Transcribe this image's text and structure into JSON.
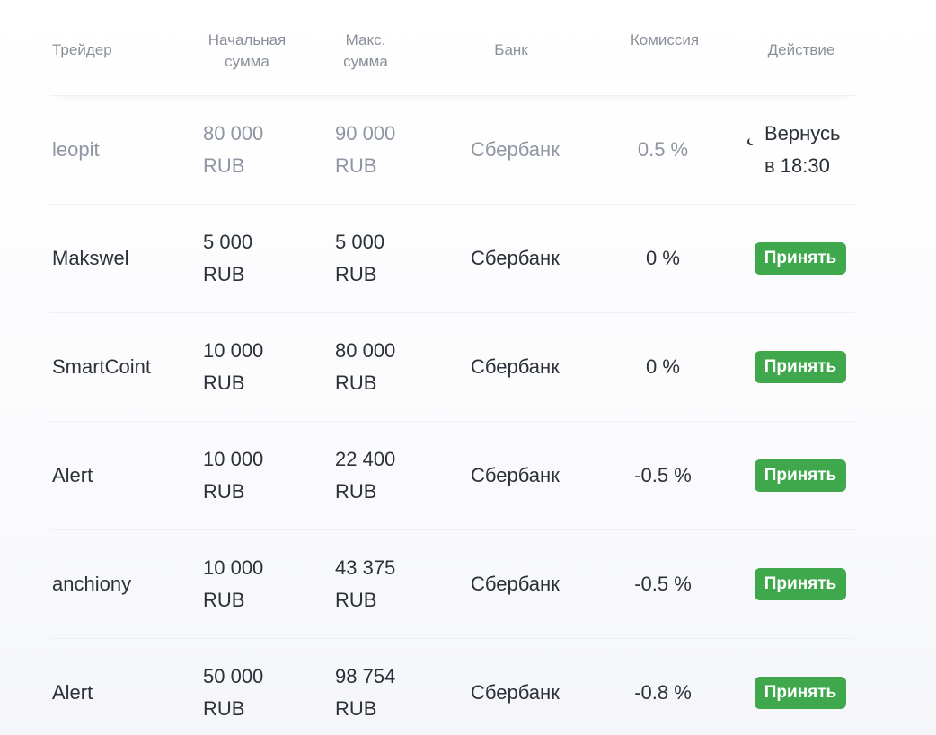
{
  "headers": {
    "trader": "Трейдер",
    "start_amount": [
      "Начальная",
      "сумма"
    ],
    "max_amount": [
      "Макс.",
      "сумма"
    ],
    "bank": "Банк",
    "fee": "Комиссия",
    "action": "Действие"
  },
  "rows": [
    {
      "trader": "leopit",
      "start_amount": [
        "80 000",
        "RUB"
      ],
      "max_amount": [
        "90 000",
        "RUB"
      ],
      "bank": "Сбербанк",
      "fee": "0.5 %",
      "action": {
        "type": "away",
        "text": [
          "Вернусь",
          "в 18:30"
        ]
      }
    },
    {
      "trader": "Makswel",
      "start_amount": [
        "5 000",
        "RUB"
      ],
      "max_amount": [
        "5 000",
        "RUB"
      ],
      "bank": "Сбербанк",
      "fee": "0 %",
      "action": {
        "type": "button",
        "label": "Принять"
      }
    },
    {
      "trader": "SmartCoint",
      "start_amount": [
        "10 000",
        "RUB"
      ],
      "max_amount": [
        "80 000",
        "RUB"
      ],
      "bank": "Сбербанк",
      "fee": "0 %",
      "action": {
        "type": "button",
        "label": "Принять"
      }
    },
    {
      "trader": "Alert",
      "start_amount": [
        "10 000",
        "RUB"
      ],
      "max_amount": [
        "22 400",
        "RUB"
      ],
      "bank": "Сбербанк",
      "fee": "-0.5 %",
      "action": {
        "type": "button",
        "label": "Принять"
      }
    },
    {
      "trader": "anchiony",
      "start_amount": [
        "10 000",
        "RUB"
      ],
      "max_amount": [
        "43 375",
        "RUB"
      ],
      "bank": "Сбербанк",
      "fee": "-0.5 %",
      "action": {
        "type": "button",
        "label": "Принять"
      }
    },
    {
      "trader": "Alert",
      "start_amount": [
        "50 000",
        "RUB"
      ],
      "max_amount": [
        "98 754",
        "RUB"
      ],
      "bank": "Сбербанк",
      "fee": "-0.8 %",
      "action": {
        "type": "button",
        "label": "Принять"
      }
    }
  ],
  "colors": {
    "accept_button": "#3fa84c",
    "away_row_text": "#8f96a3",
    "header_text": "#8a909a"
  },
  "icons": {
    "away_status": "moon-icon"
  }
}
